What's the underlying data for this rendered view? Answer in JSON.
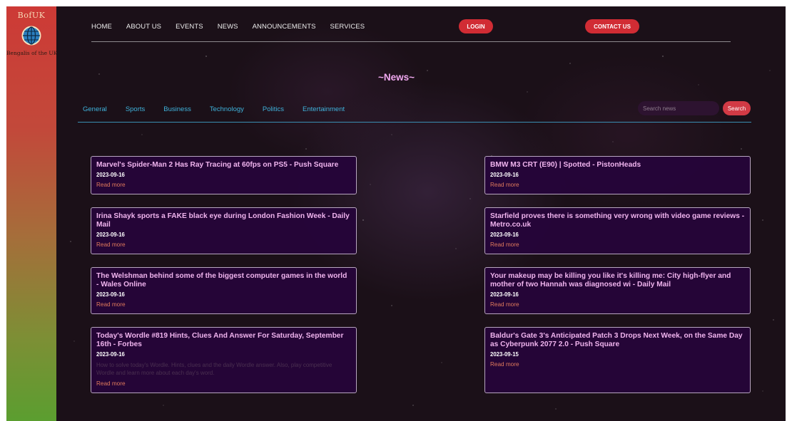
{
  "logo": {
    "top_text": "BofUK",
    "bottom_text": "Bengalis of the UK"
  },
  "nav": {
    "items": [
      "HOME",
      "ABOUT US",
      "EVENTS",
      "NEWS",
      "ANNOUNCEMENTS",
      "SERVICES"
    ],
    "login_label": "LOGIN",
    "contact_label": "CONTACT US"
  },
  "page": {
    "title": "~News~"
  },
  "categories": [
    "General",
    "Sports",
    "Business",
    "Technology",
    "Politics",
    "Entertainment"
  ],
  "search": {
    "placeholder": "Search news",
    "button_label": "Search"
  },
  "colors": {
    "accent_red": "#d12c34",
    "title_pink": "#f0a8f0",
    "link_blue": "#3fb3dc",
    "card_bg": "#26043a"
  },
  "articles": [
    {
      "title": "Marvel's Spider-Man 2 Has Ray Tracing at 60fps on PS5 - Push Square",
      "date": "2023-09-16",
      "description": "",
      "link": "Read more"
    },
    {
      "title": "BMW M3 CRT (E90) | Spotted - PistonHeads",
      "date": "2023-09-16",
      "description": "",
      "link": "Read more"
    },
    {
      "title": "Irina Shayk sports a FAKE black eye during London Fashion Week - Daily Mail",
      "date": "2023-09-16",
      "description": "",
      "link": "Read more"
    },
    {
      "title": "Starfield proves there is something very wrong with video game reviews - Metro.co.uk",
      "date": "2023-09-16",
      "description": "",
      "link": "Read more"
    },
    {
      "title": "The Welshman behind some of the biggest computer games in the world - Wales Online",
      "date": "2023-09-16",
      "description": "",
      "link": "Read more"
    },
    {
      "title": "Your makeup may be killing you like it's killing me: City high-flyer and mother of two Hannah was diagnosed wi - Daily Mail",
      "date": "2023-09-16",
      "description": "",
      "link": "Read more"
    },
    {
      "title": "Today's Wordle #819 Hints, Clues And Answer For Saturday, September 16th - Forbes",
      "date": "2023-09-16",
      "description": "How to solve today's Wordle. Hints, clues and the daily Wordle answer. Also, play competitive Wordle and learn more about each day's word.",
      "link": "Read more"
    },
    {
      "title": "Baldur's Gate 3's Anticipated Patch 3 Drops Next Week, on the Same Day as Cyberpunk 2077 2.0 - Push Square",
      "date": "2023-09-15",
      "description": "",
      "link": "Read more"
    }
  ]
}
